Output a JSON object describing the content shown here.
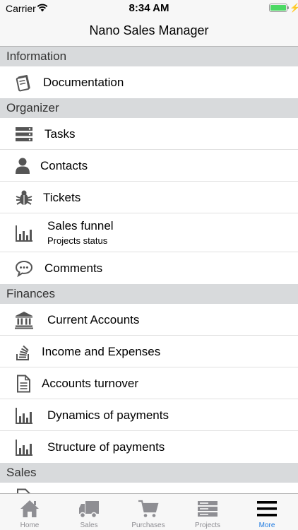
{
  "status_bar": {
    "carrier": "Carrier",
    "time": "8:34 AM"
  },
  "nav": {
    "title": "Nano Sales Manager"
  },
  "sections": {
    "information": {
      "header": "Information",
      "items": [
        {
          "label": "Documentation",
          "icon": "book-icon"
        }
      ]
    },
    "organizer": {
      "header": "Organizer",
      "items": [
        {
          "label": "Tasks",
          "icon": "server-stack-icon"
        },
        {
          "label": "Contacts",
          "icon": "person-icon"
        },
        {
          "label": "Tickets",
          "icon": "bug-icon"
        },
        {
          "label": "Sales funnel",
          "sublabel": "Projects status",
          "icon": "bar-chart-icon"
        },
        {
          "label": "Comments",
          "icon": "speech-bubble-icon"
        }
      ]
    },
    "finances": {
      "header": "Finances",
      "items": [
        {
          "label": "Current Accounts",
          "icon": "bank-icon"
        },
        {
          "label": "Income and Expenses",
          "icon": "stack-icon"
        },
        {
          "label": "Accounts turnover",
          "icon": "document-icon"
        },
        {
          "label": "Dynamics of payments",
          "icon": "bar-chart-icon"
        },
        {
          "label": "Structure of payments",
          "icon": "bar-chart-icon"
        }
      ]
    },
    "sales": {
      "header": "Sales"
    }
  },
  "tab_bar": {
    "tabs": [
      {
        "label": "Home",
        "icon": "house-icon"
      },
      {
        "label": "Sales",
        "icon": "truck-icon"
      },
      {
        "label": "Purchases",
        "icon": "cart-icon"
      },
      {
        "label": "Projects",
        "icon": "server-stack-icon"
      },
      {
        "label": "More",
        "icon": "hamburger-icon",
        "active": true
      }
    ]
  },
  "colors": {
    "accent": "#1e7ae0",
    "section_header_bg": "#d8dadc",
    "icon_gray": "#555555",
    "tab_inactive": "#8e8e93"
  }
}
